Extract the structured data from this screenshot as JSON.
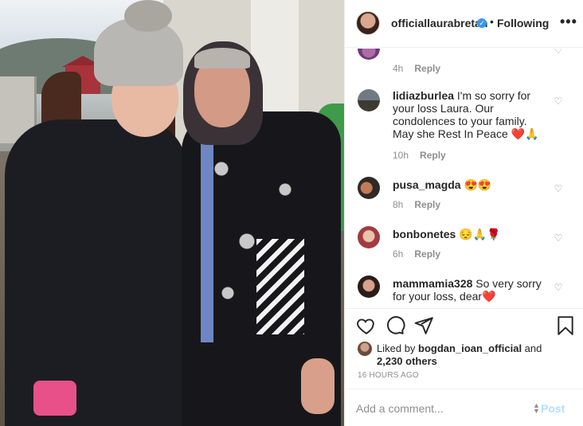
{
  "post": {
    "username": "officiallaurabretan",
    "separator": "•",
    "following_label": "Following",
    "more_label": "•••"
  },
  "comments": [
    {
      "username": "",
      "text": "",
      "time": "4h",
      "reply_label": "Reply"
    },
    {
      "username": "lidiazburlea",
      "text": " I'm so sorry for your loss Laura. Our condolences to your family. May she Rest In Peace ❤️🙏",
      "time": "10h",
      "reply_label": "Reply"
    },
    {
      "username": "pusa_magda",
      "text": " 😍😍",
      "time": "8h",
      "reply_label": "Reply"
    },
    {
      "username": "bonbonetes",
      "text": " 😔🙏🌹",
      "time": "6h",
      "reply_label": "Reply"
    },
    {
      "username": "mammamia328",
      "text": " So very sorry for your loss, dear❤️",
      "time": "",
      "reply_label": ""
    }
  ],
  "likes": {
    "prefix": "Liked by ",
    "user": "bogdan_ioan_official",
    "middle": " and",
    "others": "2,230 others"
  },
  "timestamp": "16 HOURS AGO",
  "add_comment": {
    "placeholder": "Add a comment...",
    "post_label": "Post"
  },
  "icons": {
    "like": "heart-icon",
    "comment": "comment-icon",
    "share": "paper-plane-icon",
    "save": "bookmark-icon",
    "verified": "verified-badge-icon"
  },
  "colors": {
    "verified": "#3897f0",
    "post_button_disabled": "#b2dffc",
    "meta_text": "#8e8e8e"
  }
}
